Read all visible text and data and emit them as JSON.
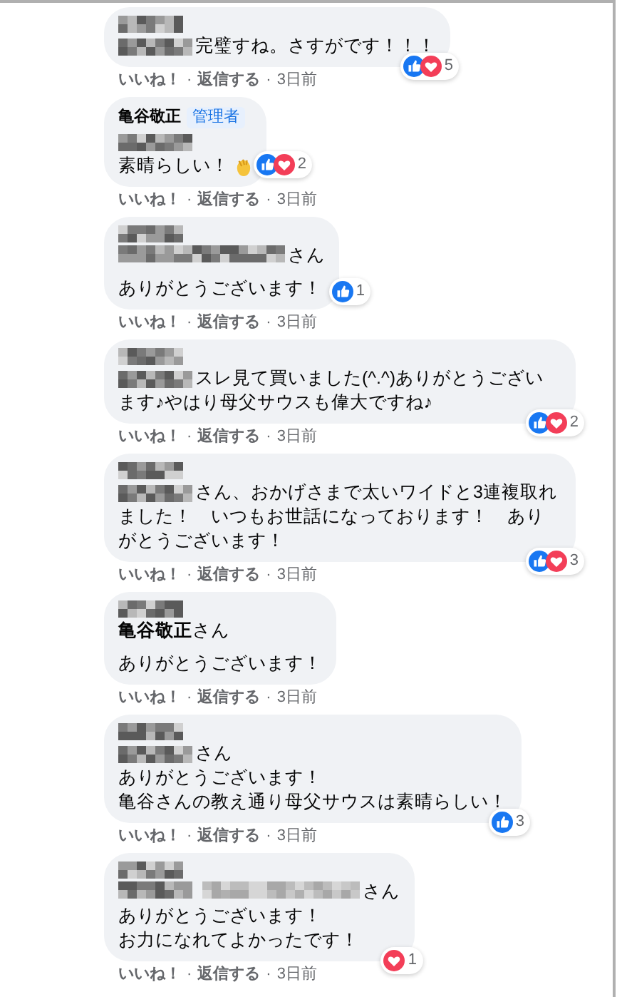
{
  "separator": "·",
  "comments": [
    {
      "author": {
        "kind": "mosaic"
      },
      "paragraphs": [
        [
          {
            "kind": "after_mosaic",
            "text": "完璧すね。さすがです！！！"
          }
        ]
      ],
      "reactions": [
        {
          "kind": "like"
        },
        {
          "kind": "love"
        }
      ],
      "reaction_count": "5",
      "footer": [
        {
          "kind": "action",
          "text": "いいね！"
        },
        {
          "kind": "action",
          "text": "返信する"
        },
        {
          "kind": "time",
          "text": "3日前"
        }
      ]
    },
    {
      "author": {
        "kind": "name",
        "text": "亀谷敬正",
        "badge": "管理者"
      },
      "paragraphs": [
        [
          {
            "kind": "mosaic_only"
          },
          {
            "kind": "with_clap",
            "text": "素晴らしい！"
          }
        ]
      ],
      "reactions": [
        {
          "kind": "like"
        },
        {
          "kind": "love"
        }
      ],
      "reaction_count": "2",
      "footer": [
        {
          "kind": "action",
          "text": "いいね！"
        },
        {
          "kind": "action",
          "text": "返信する"
        },
        {
          "kind": "time",
          "text": "3日前"
        }
      ]
    },
    {
      "author": {
        "kind": "mosaic"
      },
      "paragraphs": [
        [
          {
            "kind": "after_long_mosaic",
            "text": "さん"
          }
        ],
        [
          {
            "kind": "plain",
            "text": "ありがとうございます！"
          }
        ]
      ],
      "reactions": [
        {
          "kind": "like"
        }
      ],
      "reaction_count": "1",
      "footer": [
        {
          "kind": "action",
          "text": "いいね！"
        },
        {
          "kind": "action",
          "text": "返信する"
        },
        {
          "kind": "time",
          "text": "3日前"
        }
      ]
    },
    {
      "author": {
        "kind": "mosaic"
      },
      "paragraphs": [
        [
          {
            "kind": "after_mosaic",
            "text": "スレ見て買いました(^.^)ありがとうございます♪やはり母父サウスも偉大ですね♪"
          }
        ]
      ],
      "reactions": [
        {
          "kind": "like"
        },
        {
          "kind": "love"
        }
      ],
      "reaction_count": "2",
      "footer": [
        {
          "kind": "action",
          "text": "いいね！"
        },
        {
          "kind": "action",
          "text": "返信する"
        },
        {
          "kind": "time",
          "text": "3日前"
        }
      ]
    },
    {
      "author": {
        "kind": "mosaic"
      },
      "paragraphs": [
        [
          {
            "kind": "after_mosaic",
            "text": "さん、おかげさまで太いワイドと3連複取れました！　いつもお世話になっております！　ありがとうございます！"
          }
        ]
      ],
      "reactions": [
        {
          "kind": "like"
        },
        {
          "kind": "love"
        }
      ],
      "reaction_count": "3",
      "footer": [
        {
          "kind": "action",
          "text": "いいね！"
        },
        {
          "kind": "action",
          "text": "返信する"
        },
        {
          "kind": "time",
          "text": "3日前"
        }
      ]
    },
    {
      "author": {
        "kind": "mosaic"
      },
      "paragraphs": [
        [
          {
            "kind": "after_name",
            "name": "亀谷敬正",
            "text": "さん"
          }
        ],
        [
          {
            "kind": "plain",
            "text": "ありがとうございます！"
          }
        ]
      ],
      "footer": [
        {
          "kind": "action",
          "text": "いいね！"
        },
        {
          "kind": "action",
          "text": "返信する"
        },
        {
          "kind": "time",
          "text": "3日前"
        }
      ]
    },
    {
      "author": {
        "kind": "mosaic"
      },
      "paragraphs": [
        [
          {
            "kind": "after_mosaic",
            "text": "さん"
          },
          {
            "kind": "plain",
            "text": "ありがとうございます！"
          },
          {
            "kind": "plain",
            "text": "亀谷さんの教え通り母父サウスは素晴らしい！"
          }
        ]
      ],
      "reactions": [
        {
          "kind": "like"
        }
      ],
      "reaction_count": "3",
      "footer": [
        {
          "kind": "action",
          "text": "いいね！"
        },
        {
          "kind": "action",
          "text": "返信する"
        },
        {
          "kind": "time",
          "text": "3日前"
        }
      ]
    },
    {
      "author": {
        "kind": "mosaic"
      },
      "paragraphs": [
        [
          {
            "kind": "after_two_mosaics",
            "text": "さん"
          },
          {
            "kind": "plain",
            "text": "ありがとうございます！"
          },
          {
            "kind": "plain",
            "text": "お力になれてよかったです！"
          }
        ]
      ],
      "reactions": [
        {
          "kind": "love"
        }
      ],
      "reaction_count": "1",
      "footer": [
        {
          "kind": "action",
          "text": "いいね！"
        },
        {
          "kind": "action",
          "text": "返信する"
        },
        {
          "kind": "time",
          "text": "3日前"
        }
      ]
    }
  ]
}
